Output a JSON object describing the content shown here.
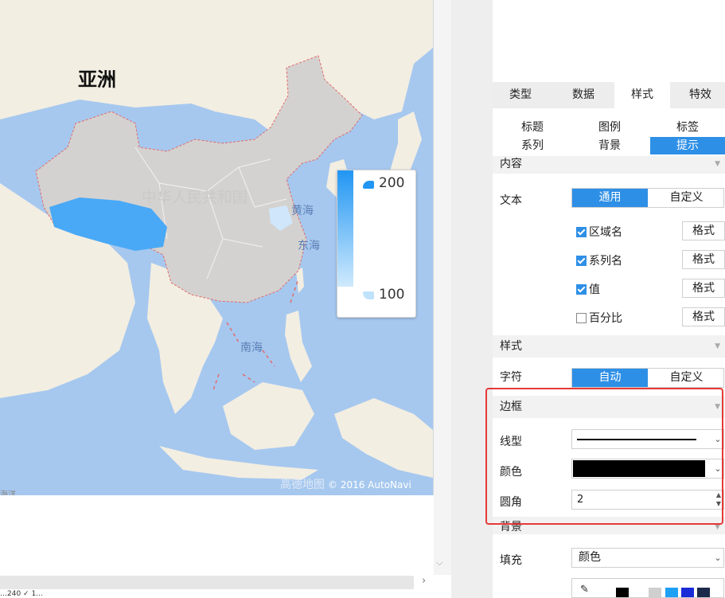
{
  "map": {
    "title": "亚洲",
    "country_label": "中华人民共和国",
    "sea_labels": {
      "huanghai": "黄海",
      "donghai": "东海",
      "nanhai": "南海"
    },
    "attribution_brand": "高德地图",
    "attribution_text": "© 2016 AutoNavi",
    "sea_edge_label": "海洋",
    "legend": {
      "max": "200",
      "min": "100",
      "color_max": "#2196f3",
      "color_min": "#cfeafd"
    },
    "colors": {
      "water": "#a6c8ef",
      "land": "#f3eee2",
      "china": "#d4d2d0",
      "highlight": "#49a9f7",
      "border": "#e26b6b"
    }
  },
  "status_strip_text": "…240  ✓ 1…",
  "panel": {
    "tabs": [
      {
        "label": "类型"
      },
      {
        "label": "数据"
      },
      {
        "label": "样式"
      },
      {
        "label": "特效"
      }
    ],
    "subtabs": [
      {
        "label": "标题"
      },
      {
        "label": "图例"
      },
      {
        "label": "标签"
      },
      {
        "label": "系列"
      },
      {
        "label": "背景"
      },
      {
        "label": "提示"
      }
    ],
    "content_section": "内容",
    "text_label": "文本",
    "text_mode": {
      "on": "通用",
      "off": "自定义"
    },
    "checks": [
      {
        "label": "区域名",
        "checked": true,
        "format": "格式"
      },
      {
        "label": "系列名",
        "checked": true,
        "format": "格式"
      },
      {
        "label": "值",
        "checked": true,
        "format": "格式"
      },
      {
        "label": "百分比",
        "checked": false,
        "format": "格式"
      }
    ],
    "style_section": "样式",
    "char_label": "字符",
    "char_mode": {
      "on": "自动",
      "off": "自定义"
    },
    "border_section": "边框",
    "line_type_label": "线型",
    "color_label": "颜色",
    "radius_label": "圆角",
    "radius_value": "2",
    "bg_section": "背景",
    "fill_label": "填充",
    "fill_value": "颜色",
    "accent": "#2e8fe6"
  }
}
